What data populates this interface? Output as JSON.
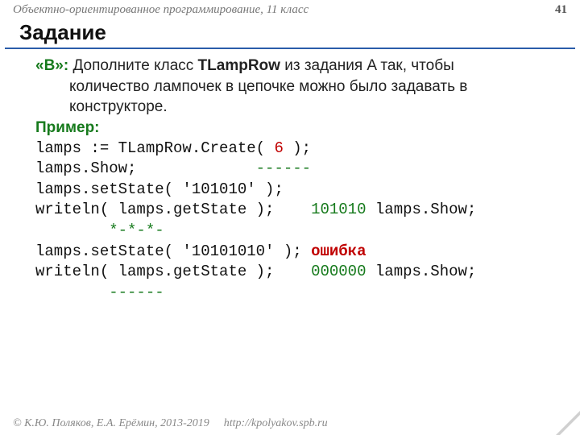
{
  "header": {
    "subject": "Объектно-ориентированное программирование, 11 класс",
    "page": "41"
  },
  "title": "Задание",
  "task": {
    "label": "«B»:",
    "text1": " Дополните класс ",
    "classname": "TLampRow",
    "text2": " из задания A так, чтобы",
    "cont1": "количество лампочек в цепочке можно было задавать в",
    "cont2": "конструкторе."
  },
  "example_label": "Пример",
  "code": {
    "l1a": "lamps := TLampRow.Create( ",
    "l1n": "6",
    "l1b": " );",
    "l2a": "lamps.Show;             ",
    "l2g": "------",
    "l3": "lamps.setState( '101010' );",
    "l4a": "writeln( lamps.getState );    ",
    "l4g": "101010",
    "l4c": " lamps.Show;",
    "l5g": "        *-*-*-",
    "l6a": "lamps.setState( '10101010' ); ",
    "l6e": "ошибка",
    "l7a": "writeln( lamps.getState );    ",
    "l7g": "000000",
    "l7c": " lamps.Show;",
    "l8g": "        ------"
  },
  "footer": {
    "copyright": "© К.Ю. Поляков, Е.А. Ерёмин, 2013-2019",
    "link": "http://kpolyakov.spb.ru"
  }
}
